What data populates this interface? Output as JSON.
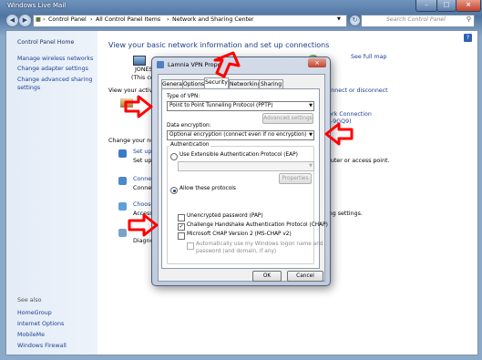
{
  "window": {
    "title": "Windows Live Mail",
    "minimize": "–",
    "maximize": "□",
    "close": "×"
  },
  "addressbar": {
    "crumbs": [
      "Control Panel",
      "All Control Panel Items",
      "Network and Sharing Center"
    ],
    "search_placeholder": "Search Control Panel"
  },
  "leftpane": {
    "home": "Control Panel Home",
    "links": [
      "Manage wireless networks",
      "Change adapter settings",
      "Change advanced sharing",
      "settings"
    ],
    "see_also": "See also",
    "see_also_links": [
      "HomeGroup",
      "Internet Options",
      "MobileMe",
      "Windows Firewall"
    ]
  },
  "main": {
    "heading": "View your basic network information and set up connections",
    "see_full_map": "See full map",
    "computer_name": "JONES",
    "computer_sub": "(This com",
    "view_active": "View your activ",
    "connect_disconnect": "Connect or disconnect",
    "network_connection": "work Connection",
    "network_id": "b2-9GQ9)",
    "change_network": "Change your ne",
    "setup_link": "Set up",
    "setup_desc": "Set up",
    "router_text": "outer or access point.",
    "connect_link": "Connec",
    "connect_desc": "Connec",
    "choose_link": "Choose",
    "choose_desc": "Access",
    "settings_text": "ing settings.",
    "diagnose_desc": "Diagno"
  },
  "dialog": {
    "title": "Lamnia VPN Prope",
    "tabs": [
      "General",
      "Options",
      "Security",
      "Networking",
      "Sharing"
    ],
    "selected_tab": "Security",
    "type_of_vpn_label": "Type of VPN:",
    "type_of_vpn_value": "Point to Point Tunneling Protocol (PPTP)",
    "advanced_settings": "Advanced settings",
    "data_encryption_label": "Data encryption:",
    "data_encryption_value": "Optional encryption (connect even if no encryption)",
    "authentication_label": "Authentication",
    "eap_label": "Use Extensible Authentication Protocol (EAP)",
    "properties": "Properties",
    "allow_protocols": "Allow these protocols",
    "protocols": [
      {
        "label": "Unencrypted password (PAP)",
        "checked": false
      },
      {
        "label": "Challenge Handshake Authentication Protocol (CHAP)",
        "checked": true
      },
      {
        "label": "Microsoft CHAP Version 2 (MS-CHAP v2)",
        "checked": false
      }
    ],
    "auto_logon_line1": "Automatically use my Windows logon name and",
    "auto_logon_line2": "password (and domain, if any)",
    "ok": "OK",
    "cancel": "Cancel"
  },
  "annotation_color": "#ff0000"
}
